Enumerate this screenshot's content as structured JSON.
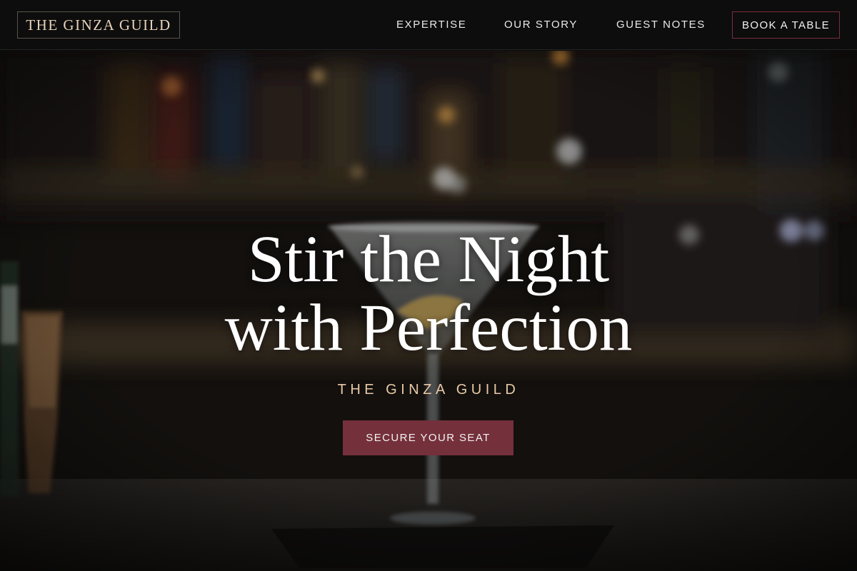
{
  "header": {
    "logo": "THE GINZA GUILD",
    "nav": {
      "expertise": "EXPERTISE",
      "story": "OUR STORY",
      "notes": "GUEST NOTES"
    },
    "book_label": "BOOK A TABLE"
  },
  "hero": {
    "headline_line1": "Stir the Night",
    "headline_line2": "with Perfection",
    "tagline": "THE GINZA GUILD",
    "cta_label": "SECURE YOUR SEAT"
  },
  "colors": {
    "accent": "#74303b",
    "logo_gold": "#e7d2b8",
    "tagline_gold": "#e9c9a6"
  }
}
